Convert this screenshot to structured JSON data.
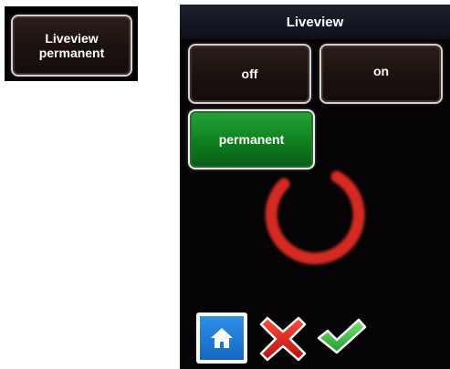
{
  "left_widget": {
    "label_line1": "Liveview",
    "label_line2": "permanent"
  },
  "screen": {
    "title": "Liveview",
    "options": [
      {
        "label": "off",
        "selected": false
      },
      {
        "label": "on",
        "selected": false
      },
      {
        "label": "permanent",
        "selected": true
      }
    ],
    "bottom_icons": [
      "home-icon",
      "cancel-x-icon",
      "confirm-check-icon"
    ]
  },
  "colors": {
    "selected": "#1a9430",
    "button_dark": "#1a120f",
    "spinner": "#d42a22",
    "home_blue": "#1f7ad6",
    "cancel_red": "#e0201c",
    "confirm_green": "#2bb43a"
  }
}
